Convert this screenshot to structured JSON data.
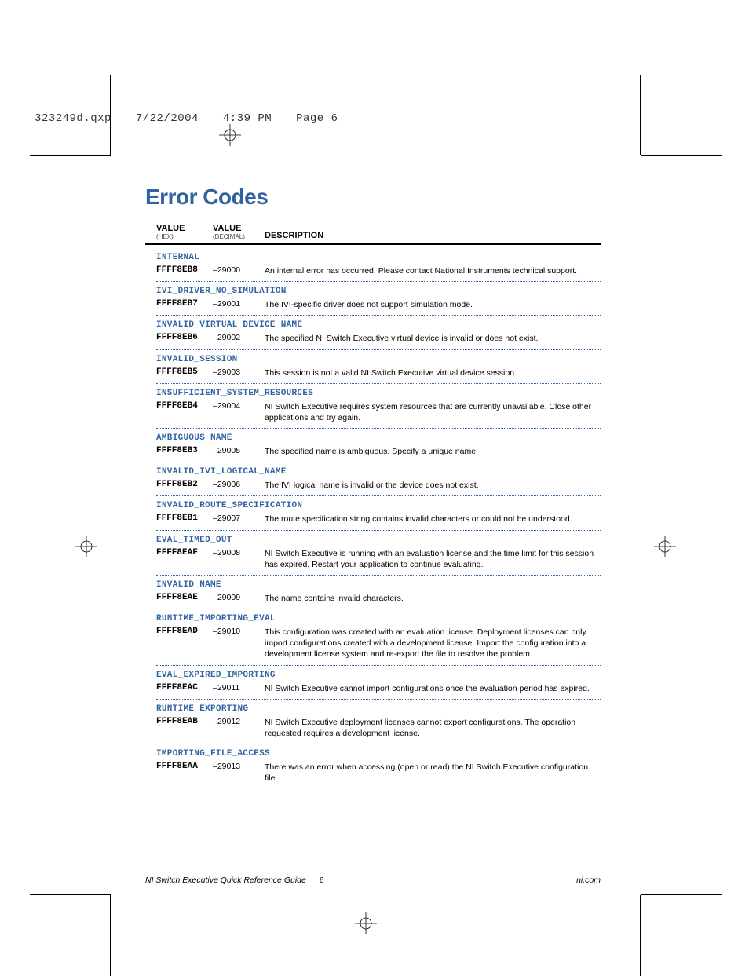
{
  "print_header": {
    "file": "323249d.qxp",
    "date": "7/22/2004",
    "time": "4:39 PM",
    "page": "Page 6"
  },
  "title": "Error Codes",
  "columns": {
    "c1_top": "VALUE",
    "c1_sub": "(HEX)",
    "c2_top": "VALUE",
    "c2_sub": "(DECIMAL)",
    "c3_top": "DESCRIPTION"
  },
  "errors": [
    {
      "name": "INTERNAL",
      "hex": "FFFF8EB8",
      "dec": "–29000",
      "desc": "An internal error has occurred. Please contact National Instruments technical support."
    },
    {
      "name": "IVI_DRIVER_NO_SIMULATION",
      "hex": "FFFF8EB7",
      "dec": "–29001",
      "desc": "The IVI-specific driver does not support simulation mode."
    },
    {
      "name": "INVALID_VIRTUAL_DEVICE_NAME",
      "hex": "FFFF8EB6",
      "dec": "–29002",
      "desc": "The specified NI Switch Executive virtual device is invalid or does not exist."
    },
    {
      "name": "INVALID_SESSION",
      "hex": "FFFF8EB5",
      "dec": "–29003",
      "desc": "This session is not a valid NI Switch Executive virtual device session."
    },
    {
      "name": "INSUFFICIENT_SYSTEM_RESOURCES",
      "hex": "FFFF8EB4",
      "dec": "–29004",
      "desc": "NI Switch Executive requires system resources that are currently unavailable. Close other applications and try again."
    },
    {
      "name": "AMBIGUOUS_NAME",
      "hex": "FFFF8EB3",
      "dec": "–29005",
      "desc": "The specified name is ambiguous. Specify a unique name."
    },
    {
      "name": "INVALID_IVI_LOGICAL_NAME",
      "hex": "FFFF8EB2",
      "dec": "–29006",
      "desc": "The IVI logical name is invalid or the device does not exist."
    },
    {
      "name": "INVALID_ROUTE_SPECIFICATION",
      "hex": "FFFF8EB1",
      "dec": "–29007",
      "desc": "The route specification string contains invalid characters or could not be understood."
    },
    {
      "name": "EVAL_TIMED_OUT",
      "hex": "FFFF8EAF",
      "dec": "–29008",
      "desc": "NI Switch Executive is running with an evaluation license and the time limit for this session has expired. Restart your application to continue evaluating."
    },
    {
      "name": "INVALID_NAME",
      "hex": "FFFF8EAE",
      "dec": "–29009",
      "desc": "The name contains invalid characters."
    },
    {
      "name": "RUNTIME_IMPORTING_EVAL",
      "hex": "FFFF8EAD",
      "dec": "–29010",
      "desc": "This configuration was created with an evaluation license. Deployment licenses can only import configurations created with a development license. Import the configuration into a development license system and re-export the file to resolve the problem."
    },
    {
      "name": "EVAL_EXPIRED_IMPORTING",
      "hex": "FFFF8EAC",
      "dec": "–29011",
      "desc": "NI Switch Executive cannot import configurations once the evaluation period has expired."
    },
    {
      "name": "RUNTIME_EXPORTING",
      "hex": "FFFF8EAB",
      "dec": "–29012",
      "desc": "NI Switch Executive deployment licenses cannot export configurations. The operation requested requires a development license."
    },
    {
      "name": "IMPORTING_FILE_ACCESS",
      "hex": "FFFF8EAA",
      "dec": "–29013",
      "desc": "There was an error when accessing (open or read) the NI Switch Executive configuration file."
    }
  ],
  "footer": {
    "doc_title": "NI Switch Executive Quick Reference Guide",
    "page": "6",
    "site": "ni.com"
  }
}
